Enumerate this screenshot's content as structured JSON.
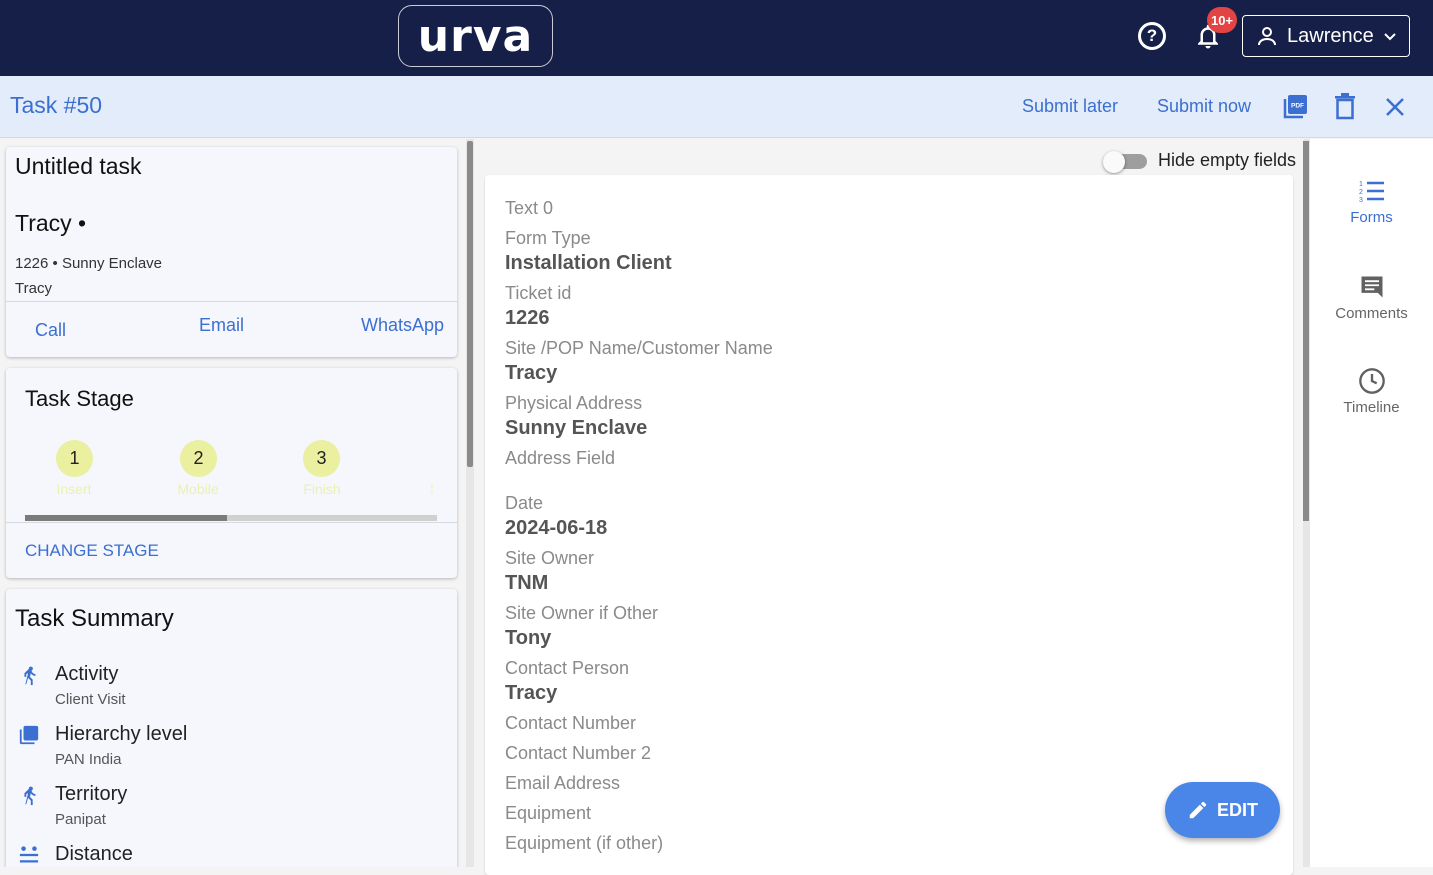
{
  "app": {
    "logo_text": "urva"
  },
  "topbar": {
    "notifications_count": "10+",
    "user_name": "Lawrence"
  },
  "header": {
    "task_title": "Task #50",
    "submit_later": "Submit later",
    "submit_now": "Submit now",
    "pdf_icon_text": "PDF"
  },
  "task_card": {
    "title": "Untitled task",
    "contact_name": "Tracy",
    "address": "1226 • Sunny Enclave",
    "sub_name": "Tracy",
    "actions": {
      "call": "Call",
      "email": "Email",
      "whatsapp": "WhatsApp"
    }
  },
  "stage_card": {
    "title": "Task Stage",
    "stages": [
      {
        "number": "1",
        "label": "Insert"
      },
      {
        "number": "2",
        "label": "Mobile"
      },
      {
        "number": "3",
        "label": "Finish"
      }
    ],
    "progress": 0.49,
    "change_stage": "CHANGE STAGE"
  },
  "summary_card": {
    "title": "Task Summary",
    "rows": [
      {
        "title": "Activity",
        "sub": "Client Visit",
        "icon": "run-icon"
      },
      {
        "title": "Hierarchy level",
        "sub": "PAN India",
        "icon": "layers-icon"
      },
      {
        "title": "Territory",
        "sub": "Panipat",
        "icon": "run-icon"
      },
      {
        "title": "Distance",
        "sub": "",
        "icon": "distance-icon"
      }
    ]
  },
  "form": {
    "hide_empty_label": "Hide empty fields",
    "fields": [
      {
        "label": "Text 0",
        "value": ""
      },
      {
        "label": "Form Type",
        "value": "Installation Client"
      },
      {
        "label": "Ticket id",
        "value": "1226"
      },
      {
        "label": "Site /POP Name/Customer Name",
        "value": "Tracy"
      },
      {
        "label": "Physical Address",
        "value": "Sunny Enclave"
      },
      {
        "label": "Address Field",
        "value": ""
      },
      {
        "label": "Date",
        "value": "2024-06-18"
      },
      {
        "label": "Site Owner",
        "value": "TNM"
      },
      {
        "label": "Site Owner if Other",
        "value": "Tony"
      },
      {
        "label": "Contact Person",
        "value": "Tracy"
      },
      {
        "label": "Contact Number",
        "value": ""
      },
      {
        "label": "Contact Number 2",
        "value": ""
      },
      {
        "label": "Email Address",
        "value": ""
      },
      {
        "label": "Equipment",
        "value": ""
      },
      {
        "label": "Equipment (if other)",
        "value": ""
      }
    ],
    "edit_label": "EDIT"
  },
  "rail": {
    "forms": "Forms",
    "comments": "Comments",
    "timeline": "Timeline"
  },
  "colors": {
    "navy": "#161f47",
    "accent": "#3b6fd1",
    "header_bg": "#e3ecfb",
    "stage_yellow": "#eaf0a0"
  }
}
